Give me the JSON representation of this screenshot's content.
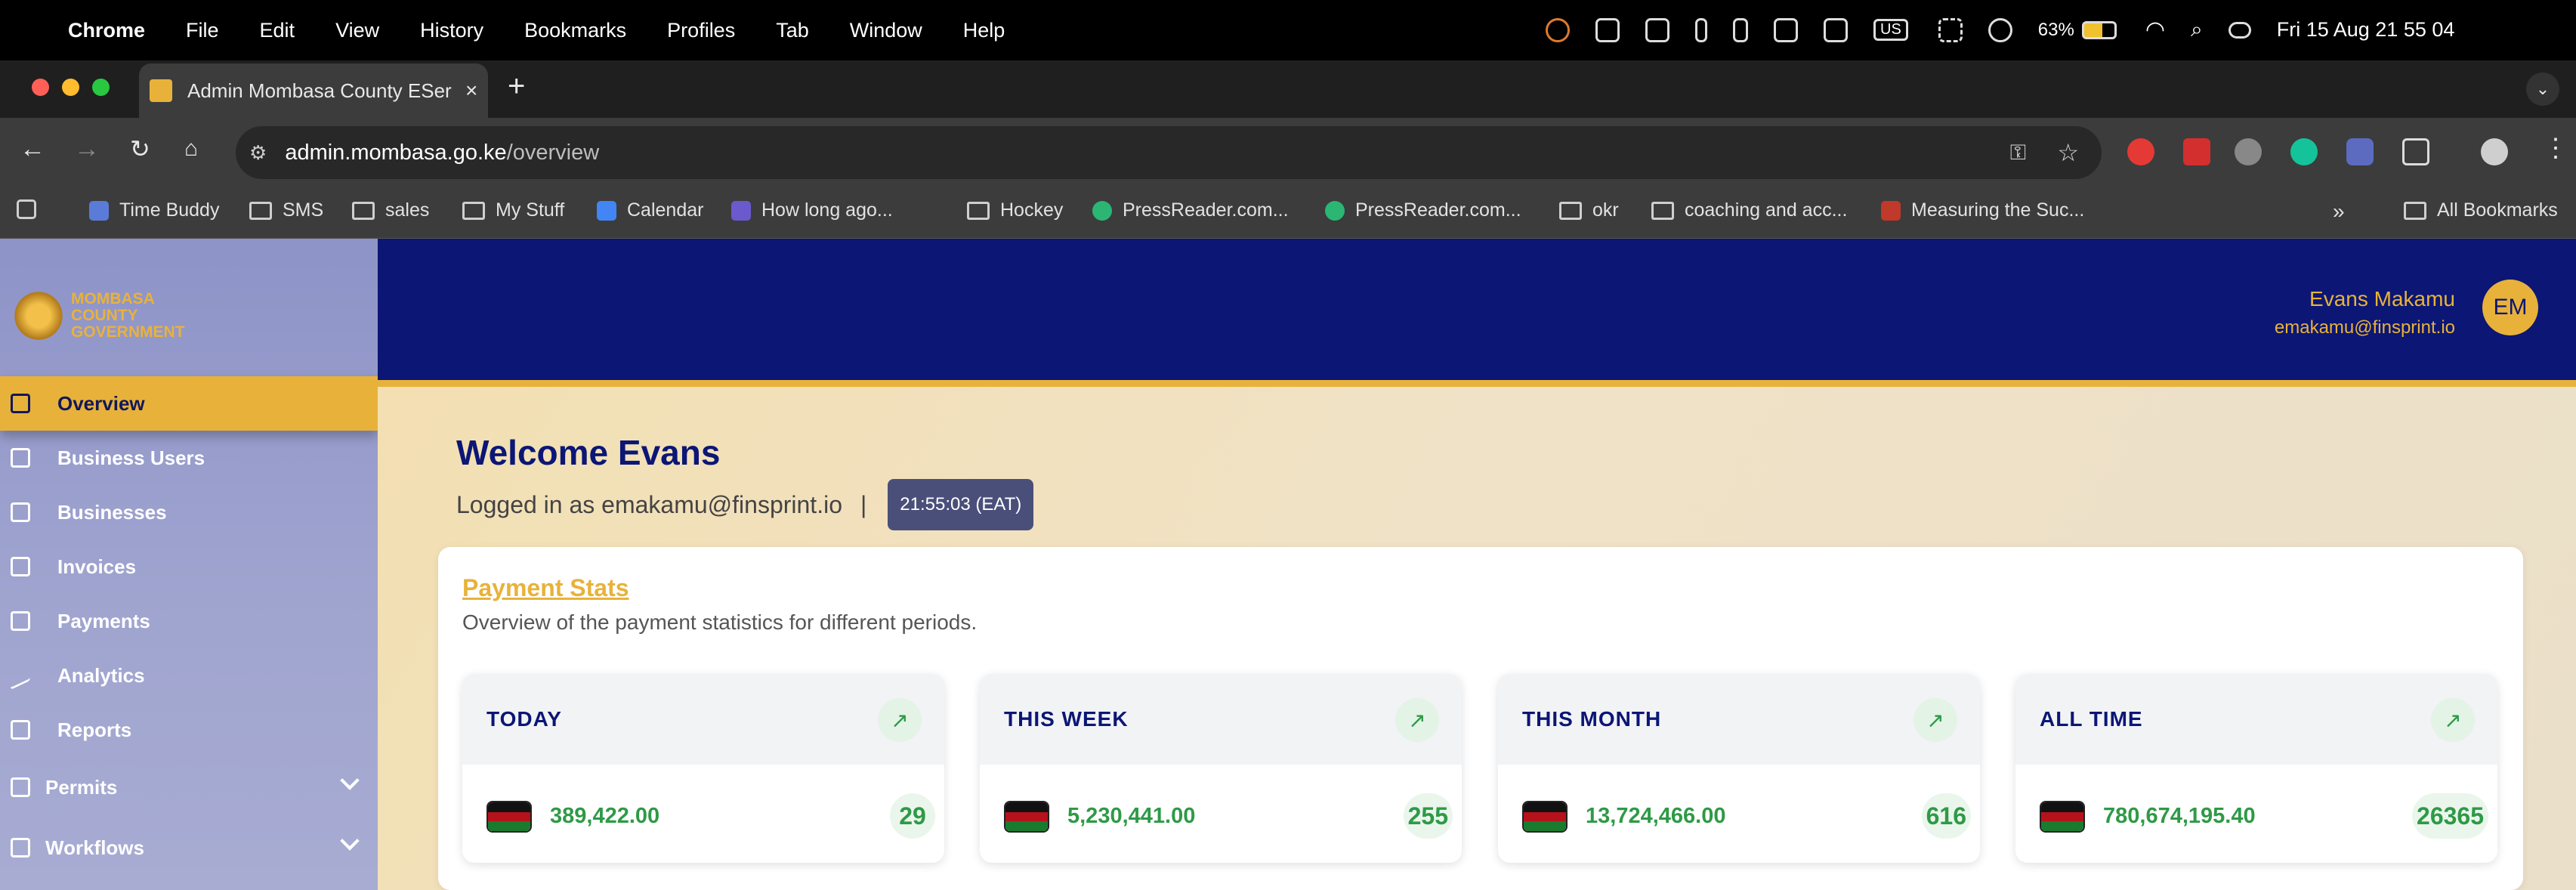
{
  "menubar": {
    "app": "Chrome",
    "items": [
      "File",
      "Edit",
      "View",
      "History",
      "Bookmarks",
      "Profiles",
      "Tab",
      "Window",
      "Help"
    ],
    "keyboard": "US",
    "battery": "63%",
    "datetime": "Fri 15 Aug  21 55 04"
  },
  "browser": {
    "tab_title": "Admin Mombasa County ESer",
    "url_host": "admin.mombasa.go.ke",
    "url_path": "/overview",
    "bookmarks": [
      "Time Buddy",
      "SMS",
      "sales",
      "My Stuff",
      "Calendar",
      "How long ago...",
      "Hockey",
      "PressReader.com...",
      "PressReader.com...",
      "okr",
      "coaching and acc...",
      "Measuring the Suc..."
    ],
    "all_bookmarks": "All Bookmarks"
  },
  "brand": {
    "line1": "MOMBASA",
    "line2": "COUNTY",
    "line3": "GOVERNMENT"
  },
  "sidebar": {
    "items": [
      {
        "label": "Overview",
        "icon": "home-icon"
      },
      {
        "label": "Business Users",
        "icon": "building-icon"
      },
      {
        "label": "Businesses",
        "icon": "briefcase-icon"
      },
      {
        "label": "Invoices",
        "icon": "layers-icon"
      },
      {
        "label": "Payments",
        "icon": "cash-icon"
      },
      {
        "label": "Analytics",
        "icon": "trend-icon"
      },
      {
        "label": "Reports",
        "icon": "layers-icon"
      },
      {
        "label": "Permits",
        "icon": "document-icon"
      },
      {
        "label": "Workflows",
        "icon": "workflow-icon"
      }
    ]
  },
  "user": {
    "name": "Evans Makamu",
    "email": "emakamu@finsprint.io",
    "initials": "EM"
  },
  "welcome": {
    "title": "Welcome Evans",
    "logged_in": "Logged in as emakamu@finsprint.io",
    "separator": "|",
    "time": "21:55:03 (EAT)"
  },
  "payment_stats": {
    "title": "Payment Stats",
    "subtitle": "Overview of the payment statistics for different periods.",
    "cards": [
      {
        "label": "TODAY",
        "amount": "389,422.00",
        "count": "29"
      },
      {
        "label": "THIS WEEK",
        "amount": "5,230,441.00",
        "count": "255"
      },
      {
        "label": "THIS MONTH",
        "amount": "13,724,466.00",
        "count": "616"
      },
      {
        "label": "ALL TIME",
        "amount": "780,674,195.40",
        "count": "26365"
      }
    ]
  },
  "colors": {
    "navy": "#0b1675",
    "gold": "#e8b23a",
    "green": "#2e9a46"
  }
}
